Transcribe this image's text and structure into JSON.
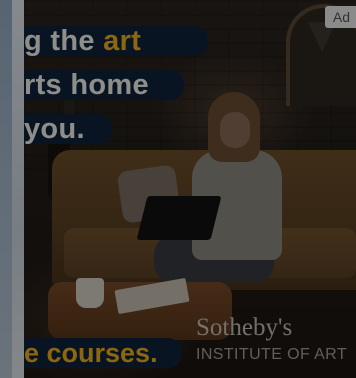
{
  "ad": {
    "badge": "Ad",
    "headline_lines": [
      {
        "prefix": "g the ",
        "accent": "art"
      },
      {
        "prefix": "rts home",
        "accent": ""
      },
      {
        "prefix": "you.",
        "accent": ""
      }
    ],
    "footer_line": "e courses.",
    "brand_name": "Sotheby's",
    "brand_subtitle": "INSTITUTE OF ART",
    "colors": {
      "headline_bg": "#10233d",
      "accent": "#f2b21b",
      "headline_text": "#f5f5f0"
    }
  }
}
